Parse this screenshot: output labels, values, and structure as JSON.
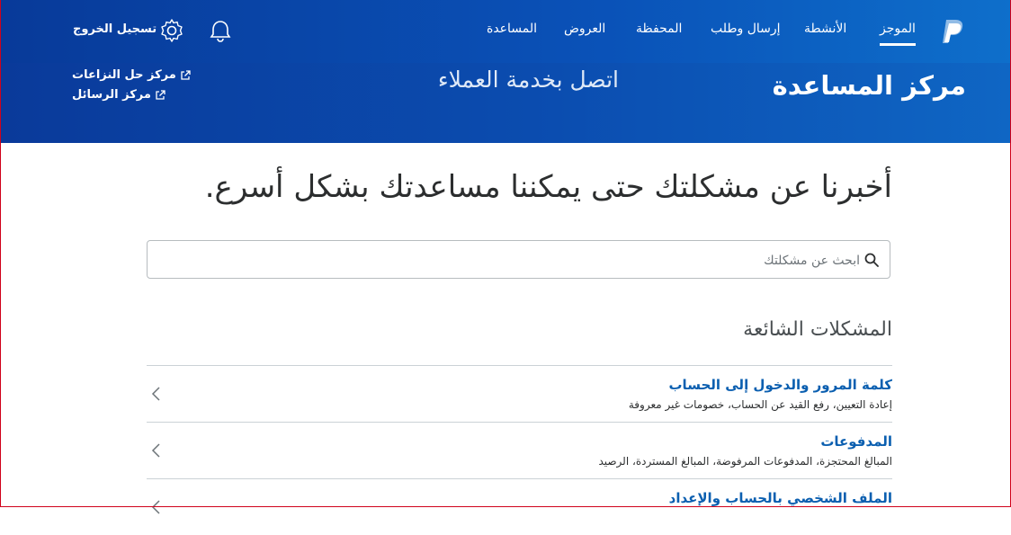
{
  "nav": {
    "items": [
      {
        "label": "الموجز"
      },
      {
        "label": "الأنشطة"
      },
      {
        "label": "إرسال وطلب"
      },
      {
        "label": "المحفظة"
      },
      {
        "label": "العروض"
      },
      {
        "label": "المساعدة"
      }
    ],
    "logout_label": "تسجيل الخروج",
    "icons": {
      "logo": "paypal-logo",
      "notifications": "bell-icon",
      "settings": "gear-icon"
    }
  },
  "header": {
    "title": "مركز المساعدة",
    "contact": "اتصل بخدمة العملاء",
    "links": [
      {
        "label": "مركز حل النزاعات"
      },
      {
        "label": "مركز الرسائل"
      }
    ]
  },
  "main": {
    "headline": "أخبرنا عن مشكلتك حتى يمكننا مساعدتك بشكل أسرع.",
    "search": {
      "placeholder": "ابحث عن مشكلتك",
      "value": ""
    },
    "section_title": "المشكلات الشائعة",
    "issues": [
      {
        "title": "كلمة المرور والدخول إلى الحساب",
        "subtitle": "إعادة التعيين، رفع القيد عن الحساب، خصومات غير معروفة"
      },
      {
        "title": "المدفوعات",
        "subtitle": "المبالغ المحتجزة، المدفوعات المرفوضة، المبالغ المستردة، الرصيد"
      },
      {
        "title": "الملف الشخصي بالحساب والإعداد",
        "subtitle": ""
      }
    ]
  },
  "colors": {
    "brand_dark": "#0a3a9a",
    "brand_light": "#0f66c4",
    "link": "#0b5fb0"
  }
}
